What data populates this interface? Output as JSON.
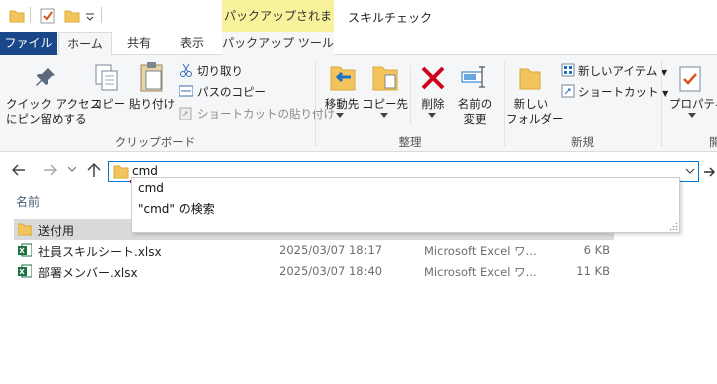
{
  "title": {
    "contextual_header": "パックアップされません",
    "window_title": "スキルチェック"
  },
  "tabs": [
    {
      "label": "ファイル"
    },
    {
      "label": "ホーム"
    },
    {
      "label": "共有"
    },
    {
      "label": "表示"
    },
    {
      "label": "パックアップ ツール"
    }
  ],
  "ribbon": {
    "clipboard": {
      "pin_label_1": "クイック アクセス",
      "pin_label_2": "にピン留めする",
      "copy": "コピー",
      "paste": "貼り付け",
      "cut": "切り取り",
      "copy_path": "パスのコピー",
      "paste_shortcut": "ショートカットの貼り付け",
      "group": "クリップボード"
    },
    "organize": {
      "move_to": "移動先",
      "copy_to": "コピー先",
      "delete": "削除",
      "rename_1": "名前の",
      "rename_2": "変更",
      "group": "整理"
    },
    "new": {
      "new_folder_1": "新しい",
      "new_folder_2": "フォルダー",
      "new_item": "新しいアイテム",
      "shortcut": "ショートカット",
      "group": "新規"
    },
    "open": {
      "properties": "プロパティ",
      "group_partial": "開"
    }
  },
  "address": {
    "value": "cmd",
    "suggestions": [
      "cmd",
      "\"cmd\" の検索"
    ]
  },
  "list": {
    "header_name": "名前",
    "rows": [
      {
        "name": "送付用",
        "date": "",
        "type": "",
        "size": "",
        "icon": "folder-icon"
      },
      {
        "name": "社員スキルシート.xlsx",
        "date": "2025/03/07 18:17",
        "type": "Microsoft Excel ワ...",
        "size": "6 KB",
        "icon": "excel-icon"
      },
      {
        "name": "部署メンバー.xlsx",
        "date": "2025/03/07 18:40",
        "type": "Microsoft Excel ワ...",
        "size": "11 KB",
        "icon": "excel-icon"
      }
    ]
  },
  "colors": {
    "file_tab": "#19478a",
    "contextual": "#f8f29c",
    "focus_border": "#0078d7",
    "delete_red": "#d0021b",
    "excel_green": "#1d6f42"
  }
}
